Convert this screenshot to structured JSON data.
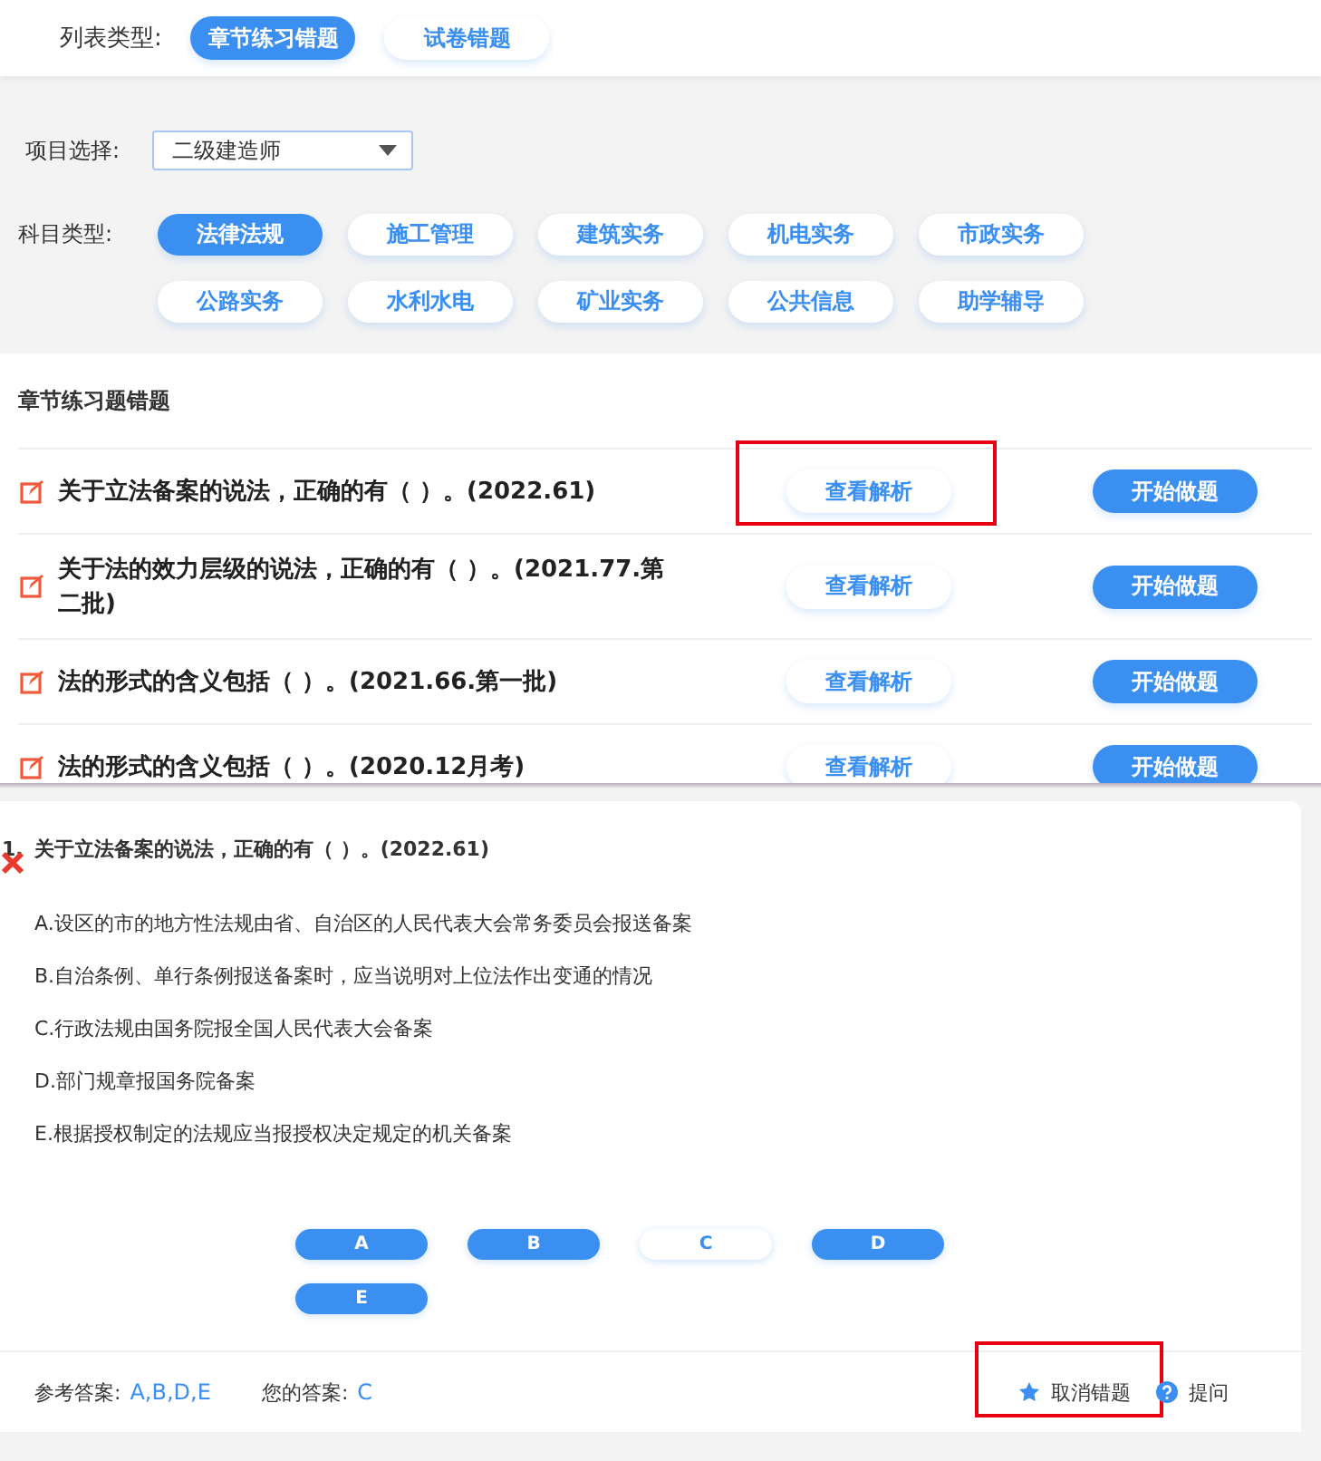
{
  "list_type": {
    "label": "列表类型:",
    "options": [
      {
        "label": "章节练习错题",
        "selected": true
      },
      {
        "label": "试卷错题",
        "selected": false
      }
    ]
  },
  "project": {
    "label": "项目选择:",
    "value": "二级建造师"
  },
  "subject": {
    "label": "科目类型:",
    "options": [
      {
        "label": "法律法规",
        "selected": true
      },
      {
        "label": "施工管理",
        "selected": false
      },
      {
        "label": "建筑实务",
        "selected": false
      },
      {
        "label": "机电实务",
        "selected": false
      },
      {
        "label": "市政实务",
        "selected": false
      },
      {
        "label": "公路实务",
        "selected": false
      },
      {
        "label": "水利水电",
        "selected": false
      },
      {
        "label": "矿业实务",
        "selected": false
      },
      {
        "label": "公共信息",
        "selected": false
      },
      {
        "label": "助学辅导",
        "selected": false
      }
    ]
  },
  "section_title": "章节练习题错题",
  "questions": [
    {
      "title": "关于立法备案的说法，正确的有（ ）。(2022.61)",
      "analysis_button": "查看解析",
      "start_button": "开始做题",
      "highlighted": true
    },
    {
      "title": "关于法的效力层级的说法，正确的有（  ）。(2021.77.第二批)",
      "analysis_button": "查看解析",
      "start_button": "开始做题",
      "highlighted": false
    },
    {
      "title": "法的形式的含义包括（  ）。(2021.66.第一批)",
      "analysis_button": "查看解析",
      "start_button": "开始做题",
      "highlighted": false
    },
    {
      "title": "法的形式的含义包括（  ）。(2020.12月考)",
      "analysis_button": "查看解析",
      "start_button": "开始做题",
      "highlighted": false
    }
  ],
  "detail": {
    "number": "1.",
    "wrong": true,
    "title": "关于立法备案的说法，正确的有（ ）。(2022.61)",
    "options": [
      "A.设区的市的地方性法规由省、自治区的人民代表大会常务委员会报送备案",
      "B.自治条例、单行条例报送备案时，应当说明对上位法作出变通的情况",
      "C.行政法规由国务院报全国人民代表大会备案",
      "D.部门规章报国务院备案",
      "E.根据授权制定的法规应当报授权决定规定的机关备案"
    ],
    "choices": [
      {
        "label": "A",
        "selected": true
      },
      {
        "label": "B",
        "selected": true
      },
      {
        "label": "C",
        "selected": false
      },
      {
        "label": "D",
        "selected": true
      },
      {
        "label": "E",
        "selected": true
      }
    ],
    "reference_label": "参考答案:",
    "reference_value": "A,B,D,E",
    "your_label": "您的答案:",
    "your_value": "C",
    "actions": [
      {
        "kind": "star",
        "label": "取消错题",
        "highlighted": true
      },
      {
        "kind": "help",
        "label": "提问",
        "highlighted": false
      }
    ]
  }
}
